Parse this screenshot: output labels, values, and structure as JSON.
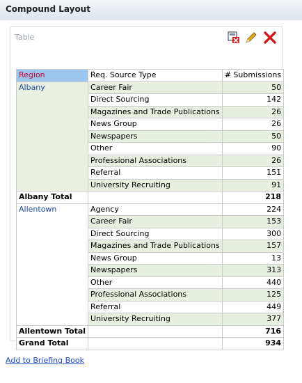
{
  "window": {
    "title": "Compound Layout"
  },
  "view": {
    "title": "Table",
    "icons": {
      "format": "format-view-icon",
      "edit": "edit-pencil-icon",
      "remove": "remove-x-icon"
    }
  },
  "table": {
    "headers": {
      "region": "Region",
      "type": "Req. Source Type",
      "submissions": "# Submissions"
    },
    "albany": {
      "region": "Albany",
      "rows": [
        {
          "type": "Career Fair",
          "value": "50"
        },
        {
          "type": "Direct Sourcing",
          "value": "142"
        },
        {
          "type": "Magazines and Trade Publications",
          "value": "26"
        },
        {
          "type": "News Group",
          "value": "26"
        },
        {
          "type": "Newspapers",
          "value": "50"
        },
        {
          "type": "Other",
          "value": "90"
        },
        {
          "type": "Professional Associations",
          "value": "26"
        },
        {
          "type": "Referral",
          "value": "151"
        },
        {
          "type": "University Recruiting",
          "value": "91"
        }
      ],
      "total_label": "Albany Total",
      "total_value": "218"
    },
    "allentown": {
      "region": "Allentown",
      "rows": [
        {
          "type": "Agency",
          "value": "224"
        },
        {
          "type": "Career Fair",
          "value": "153"
        },
        {
          "type": "Direct Sourcing",
          "value": "300"
        },
        {
          "type": "Magazines and Trade Publications",
          "value": "157"
        },
        {
          "type": "News Group",
          "value": "13"
        },
        {
          "type": "Newspapers",
          "value": "313"
        },
        {
          "type": "Other",
          "value": "440"
        },
        {
          "type": "Professional Associations",
          "value": "125"
        },
        {
          "type": "Referral",
          "value": "449"
        },
        {
          "type": "University Recruiting",
          "value": "377"
        }
      ],
      "total_label": "Allentown Total",
      "total_value": "716"
    },
    "grand_total_label": "Grand Total",
    "grand_total_value": "934"
  },
  "footer": {
    "briefing_link": "Add to Briefing Book"
  },
  "colors": {
    "region_header_bg": "#9cc6ee",
    "region_header_text": "#c8002d",
    "region_text": "#1a4aa3",
    "row_shade": "#e7f0e0",
    "link": "#1f49c4",
    "remove_icon": "#d11a1a"
  }
}
